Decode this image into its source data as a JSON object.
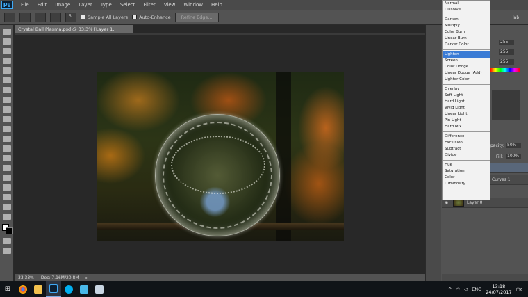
{
  "menubar": {
    "logo": "Ps",
    "items": [
      "File",
      "Edit",
      "Image",
      "Layer",
      "Type",
      "Select",
      "Filter",
      "View",
      "Window",
      "Help"
    ]
  },
  "options": {
    "brush_size": "5",
    "sample_all_layers": "Sample All Layers",
    "auto_enhance": "Auto-Enhance",
    "refine_edge": "Refine Edge..."
  },
  "document": {
    "tab_title": "Crystal Ball Plasma.psd @ 33.3% (Layer 1, RGB/8#)",
    "zoom": "33.33%",
    "doc_size": "Doc: 7.16M/20.8M"
  },
  "color_panel": {
    "values": [
      "255",
      "255",
      "255"
    ],
    "partial_label": "lab"
  },
  "layers": {
    "opacity_label": "pacity:",
    "opacity_value": "50%",
    "fill_label": "Fill:",
    "fill_value": "100%",
    "row_curves": "Curves 1",
    "row_layer0": "Layer 0"
  },
  "blend_modes": {
    "selected": "Lighten",
    "groups": [
      [
        "Normal",
        "Dissolve"
      ],
      [
        "Darken",
        "Multiply",
        "Color Burn",
        "Linear Burn",
        "Darker Color"
      ],
      [
        "Lighten",
        "Screen",
        "Color Dodge",
        "Linear Dodge (Add)",
        "Lighter Color"
      ],
      [
        "Overlay",
        "Soft Light",
        "Hard Light",
        "Vivid Light",
        "Linear Light",
        "Pin Light",
        "Hard Mix"
      ],
      [
        "Difference",
        "Exclusion",
        "Subtract",
        "Divide"
      ],
      [
        "Hue",
        "Saturation",
        "Color",
        "Luminosity"
      ]
    ]
  },
  "taskbar": {
    "lang": "ENG",
    "time": "13:18",
    "date": "24/07/2017",
    "notif_count": "6"
  }
}
